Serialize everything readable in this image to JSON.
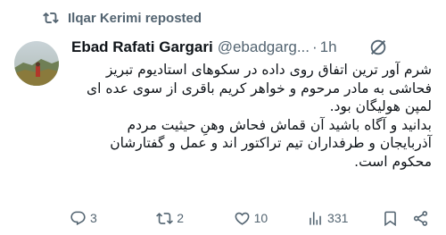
{
  "repost": {
    "text": "Ilqar Kerimi reposted"
  },
  "author": {
    "name": "Ebad Rafati Gargari",
    "handle": "@ebadgarg...",
    "separator": "·",
    "time": "1h"
  },
  "tweet": {
    "paragraph1": [
      "شرم آور ترین اتفاق روی داده در سکوهای استادیوم تبریز",
      "فحاشی به مادر مرحوم و خواهر کریم باقری  از سوی عده ای",
      "لمپن هولیگان بود."
    ],
    "paragraph2": [
      "بدانید و آگاه باشید آن قماش فحاش وهنِ حیثیت مردم",
      "آذربایجان و طرفداران تیم تراکتور اند و عمل و گفتارشان",
      "محکوم است."
    ]
  },
  "actions": {
    "replies": "3",
    "reposts": "2",
    "likes": "10",
    "views": "331"
  },
  "colors": {
    "text": "#0f1419",
    "secondary": "#536471",
    "background": "#ffffff"
  },
  "icons": [
    "repost-icon",
    "grok-icon",
    "reply-icon",
    "retweet-icon",
    "like-icon",
    "views-icon",
    "bookmark-icon",
    "share-icon"
  ]
}
